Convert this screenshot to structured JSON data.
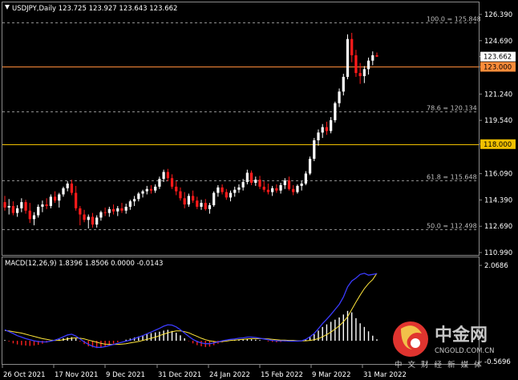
{
  "chart_data": {
    "type": "candlestick",
    "main": {
      "header": "USDJPY,Daily  123.725 123.927 123.643 123.662",
      "y_ticks": [
        "126.390",
        "124.690",
        "123.662",
        "123.000",
        "121.240",
        "119.540",
        "118.000",
        "116.090",
        "114.390",
        "112.690",
        "110.990"
      ],
      "ylim": [
        110.99,
        126.39
      ],
      "price_tag": {
        "label": "123.662",
        "value": 123.662
      },
      "h_lines": [
        {
          "label": "123.000",
          "value": 123.0,
          "color": "#ff8c3a"
        },
        {
          "label": "118.000",
          "value": 118.0,
          "color": "#f0c000"
        }
      ],
      "fib_levels": [
        {
          "label": "100.0 = 125.848",
          "value": 125.848
        },
        {
          "label": "78.6 = 120.134",
          "value": 120.134
        },
        {
          "label": "61.8 = 115.648",
          "value": 115.648
        },
        {
          "label": "50.0 = 112.498",
          "value": 112.498
        }
      ],
      "ohlc": [
        [
          114.25,
          114.65,
          113.7,
          113.9
        ],
        [
          113.9,
          114.45,
          113.45,
          114.0
        ],
        [
          114.0,
          114.3,
          113.4,
          113.55
        ],
        [
          113.55,
          114.05,
          113.3,
          113.85
        ],
        [
          113.85,
          114.5,
          113.6,
          114.25
        ],
        [
          114.25,
          114.4,
          113.5,
          113.7
        ],
        [
          113.7,
          114.2,
          112.9,
          113.15
        ],
        [
          113.15,
          113.6,
          112.75,
          113.4
        ],
        [
          113.4,
          114.1,
          113.25,
          113.95
        ],
        [
          113.95,
          114.35,
          113.6,
          114.1
        ],
        [
          114.1,
          114.5,
          113.8,
          114.0
        ],
        [
          114.0,
          114.75,
          113.85,
          114.6
        ],
        [
          114.6,
          114.95,
          114.2,
          114.35
        ],
        [
          114.35,
          114.85,
          113.9,
          114.75
        ],
        [
          114.75,
          115.25,
          114.6,
          115.15
        ],
        [
          115.15,
          115.6,
          114.95,
          115.45
        ],
        [
          115.45,
          115.7,
          114.7,
          114.85
        ],
        [
          114.85,
          115.3,
          113.7,
          113.85
        ],
        [
          113.85,
          114.0,
          112.75,
          113.45
        ],
        [
          113.45,
          113.75,
          112.95,
          113.1
        ],
        [
          113.1,
          113.45,
          112.55,
          113.3
        ],
        [
          113.3,
          113.55,
          112.6,
          112.8
        ],
        [
          112.8,
          113.4,
          112.6,
          113.25
        ],
        [
          113.25,
          113.7,
          113.05,
          113.6
        ],
        [
          113.6,
          113.9,
          113.35,
          113.55
        ],
        [
          113.55,
          113.95,
          113.3,
          113.8
        ],
        [
          113.8,
          114.1,
          113.45,
          113.65
        ],
        [
          113.65,
          114.0,
          113.35,
          113.85
        ],
        [
          113.85,
          114.2,
          113.55,
          113.7
        ],
        [
          113.7,
          114.15,
          113.5,
          113.95
        ],
        [
          113.95,
          114.4,
          113.75,
          114.3
        ],
        [
          114.3,
          114.65,
          114.0,
          114.45
        ],
        [
          114.45,
          114.9,
          114.3,
          114.8
        ],
        [
          114.8,
          115.05,
          114.55,
          114.95
        ],
        [
          114.95,
          115.3,
          114.75,
          115.1
        ],
        [
          115.1,
          115.35,
          114.8,
          115.0
        ],
        [
          115.0,
          115.4,
          114.85,
          115.25
        ],
        [
          115.25,
          115.9,
          115.1,
          115.75
        ],
        [
          115.75,
          116.35,
          115.55,
          116.2
        ],
        [
          116.2,
          116.4,
          115.6,
          115.8
        ],
        [
          115.8,
          116.05,
          115.1,
          115.25
        ],
        [
          115.25,
          115.6,
          114.7,
          114.95
        ],
        [
          114.95,
          115.2,
          114.35,
          114.5
        ],
        [
          114.5,
          114.9,
          113.85,
          114.1
        ],
        [
          114.1,
          114.8,
          113.95,
          114.65
        ],
        [
          114.65,
          115.0,
          114.2,
          114.35
        ],
        [
          114.35,
          114.6,
          113.8,
          113.95
        ],
        [
          113.95,
          114.4,
          113.75,
          114.2
        ],
        [
          114.2,
          114.45,
          113.7,
          113.8
        ],
        [
          113.8,
          114.2,
          113.5,
          114.05
        ],
        [
          114.05,
          114.95,
          113.95,
          114.85
        ],
        [
          114.85,
          115.35,
          114.6,
          115.2
        ],
        [
          115.2,
          115.4,
          114.75,
          114.9
        ],
        [
          114.9,
          115.1,
          114.4,
          114.55
        ],
        [
          114.55,
          115.0,
          114.3,
          114.85
        ],
        [
          114.85,
          115.25,
          114.6,
          115.05
        ],
        [
          115.05,
          115.4,
          114.85,
          115.2
        ],
        [
          115.2,
          115.75,
          115.0,
          115.55
        ],
        [
          115.55,
          116.35,
          115.4,
          116.15
        ],
        [
          116.15,
          116.3,
          115.35,
          115.5
        ],
        [
          115.5,
          115.9,
          115.3,
          115.7
        ],
        [
          115.7,
          115.95,
          115.1,
          115.25
        ],
        [
          115.25,
          115.6,
          114.9,
          115.05
        ],
        [
          115.05,
          115.45,
          114.75,
          114.9
        ],
        [
          114.9,
          115.3,
          114.65,
          115.15
        ],
        [
          115.15,
          115.4,
          114.85,
          115.0
        ],
        [
          115.0,
          115.5,
          114.8,
          115.35
        ],
        [
          115.35,
          115.8,
          115.1,
          115.65
        ],
        [
          115.65,
          115.9,
          115.0,
          115.1
        ],
        [
          115.1,
          115.35,
          114.7,
          114.9
        ],
        [
          114.9,
          115.4,
          114.8,
          115.3
        ],
        [
          115.3,
          115.6,
          115.0,
          115.45
        ],
        [
          115.45,
          116.25,
          115.35,
          116.1
        ],
        [
          116.1,
          117.2,
          116.0,
          117.05
        ],
        [
          117.05,
          118.4,
          116.9,
          118.25
        ],
        [
          118.25,
          118.95,
          117.9,
          118.75
        ],
        [
          118.75,
          119.3,
          118.4,
          119.1
        ],
        [
          119.1,
          119.45,
          118.6,
          118.85
        ],
        [
          118.85,
          119.75,
          118.7,
          119.55
        ],
        [
          119.55,
          120.75,
          119.4,
          120.65
        ],
        [
          120.65,
          121.6,
          120.4,
          121.4
        ],
        [
          121.4,
          122.55,
          121.15,
          122.35
        ],
        [
          122.35,
          125.1,
          122.2,
          124.8
        ],
        [
          124.8,
          125.2,
          123.3,
          123.75
        ],
        [
          123.75,
          124.1,
          122.35,
          122.6
        ],
        [
          122.6,
          123.25,
          121.9,
          122.4
        ],
        [
          122.4,
          123.05,
          121.95,
          122.85
        ],
        [
          122.85,
          123.6,
          122.5,
          123.4
        ],
        [
          123.4,
          124.0,
          123.1,
          123.75
        ],
        [
          123.75,
          123.93,
          123.64,
          123.66
        ]
      ]
    },
    "macd": {
      "header": "MACD(12,26,9) 1.8396 1.8506 0.0000 -0.0143",
      "y_ticks": [
        "2.0686",
        "-0.5696"
      ],
      "ylim": [
        -0.5696,
        2.0686
      ],
      "histogram": [
        0.02,
        -0.02,
        -0.07,
        -0.1,
        -0.12,
        -0.13,
        -0.14,
        -0.13,
        -0.11,
        -0.08,
        -0.05,
        -0.02,
        0.01,
        0.04,
        0.07,
        0.09,
        0.1,
        0.06,
        -0.02,
        -0.09,
        -0.15,
        -0.18,
        -0.2,
        -0.19,
        -0.16,
        -0.12,
        -0.08,
        -0.04,
        0.0,
        0.03,
        0.06,
        0.09,
        0.12,
        0.15,
        0.18,
        0.21,
        0.23,
        0.25,
        0.28,
        0.3,
        0.27,
        0.22,
        0.15,
        0.07,
        -0.01,
        -0.07,
        -0.12,
        -0.15,
        -0.17,
        -0.16,
        -0.12,
        -0.08,
        -0.04,
        -0.01,
        0.01,
        0.02,
        0.03,
        0.04,
        0.05,
        0.04,
        0.03,
        0.02,
        0.0,
        -0.02,
        -0.03,
        -0.04,
        -0.03,
        -0.02,
        -0.02,
        -0.02,
        -0.01,
        0.0,
        0.04,
        0.1,
        0.18,
        0.28,
        0.38,
        0.45,
        0.52,
        0.58,
        0.64,
        0.72,
        0.82,
        0.78,
        0.62,
        0.48,
        0.38,
        0.26,
        0.14,
        0.04
      ],
      "macd_line": [
        0.3,
        0.25,
        0.2,
        0.14,
        0.1,
        0.06,
        0.03,
        0.0,
        -0.02,
        -0.03,
        -0.03,
        -0.01,
        0.02,
        0.06,
        0.11,
        0.16,
        0.18,
        0.13,
        0.05,
        -0.03,
        -0.1,
        -0.15,
        -0.18,
        -0.18,
        -0.16,
        -0.13,
        -0.1,
        -0.07,
        -0.04,
        -0.01,
        0.02,
        0.06,
        0.1,
        0.14,
        0.19,
        0.24,
        0.29,
        0.34,
        0.4,
        0.44,
        0.43,
        0.38,
        0.3,
        0.21,
        0.12,
        0.04,
        -0.02,
        -0.06,
        -0.08,
        -0.08,
        -0.06,
        -0.03,
        0.0,
        0.02,
        0.04,
        0.05,
        0.07,
        0.08,
        0.1,
        0.1,
        0.09,
        0.07,
        0.05,
        0.03,
        0.01,
        0.0,
        0.0,
        0.0,
        -0.01,
        -0.01,
        -0.01,
        0.0,
        0.04,
        0.11,
        0.2,
        0.33,
        0.47,
        0.59,
        0.72,
        0.86,
        1.0,
        1.2,
        1.48,
        1.64,
        1.72,
        1.82,
        1.85,
        1.8,
        1.82,
        1.84
      ],
      "signal_line": [
        0.28,
        0.27,
        0.25,
        0.23,
        0.21,
        0.18,
        0.15,
        0.12,
        0.09,
        0.06,
        0.04,
        0.02,
        0.01,
        0.01,
        0.03,
        0.05,
        0.07,
        0.08,
        0.07,
        0.05,
        0.02,
        -0.01,
        -0.04,
        -0.07,
        -0.09,
        -0.1,
        -0.1,
        -0.1,
        -0.09,
        -0.08,
        -0.06,
        -0.04,
        -0.02,
        0.01,
        0.04,
        0.07,
        0.1,
        0.14,
        0.18,
        0.22,
        0.25,
        0.27,
        0.27,
        0.25,
        0.22,
        0.17,
        0.12,
        0.07,
        0.03,
        0.0,
        -0.02,
        -0.03,
        -0.02,
        -0.01,
        0.01,
        0.02,
        0.03,
        0.04,
        0.05,
        0.06,
        0.06,
        0.06,
        0.06,
        0.05,
        0.04,
        0.03,
        0.02,
        0.02,
        0.01,
        0.01,
        0.0,
        0.0,
        0.0,
        0.01,
        0.03,
        0.06,
        0.11,
        0.17,
        0.24,
        0.32,
        0.41,
        0.52,
        0.66,
        0.86,
        1.06,
        1.25,
        1.43,
        1.57,
        1.68,
        1.85
      ]
    },
    "x_ticks": [
      "26 Oct 2021",
      "17 Nov 2021",
      "9 Dec 2021",
      "31 Dec 2021",
      "24 Jan 2022",
      "15 Feb 2022",
      "9 Mar 2022",
      "31 Mar 2022"
    ],
    "colors": {
      "bull_candle": "#ffffff",
      "bear_candle": "#ff1a1a",
      "grid_dashes": "#bfbfbf",
      "macd_line": "#3b3bff",
      "signal_line": "#ffe63c",
      "hist_positive": "#ffffff",
      "hist_negative": "#ff2020",
      "price_tag_bg": "#ffffff",
      "orange_line_tag_bg": "#ff8c3a",
      "yellow_line_tag_bg": "#f0c000"
    }
  },
  "watermark": {
    "logo": "中金网",
    "domain": "CNGOLD.COM.CN",
    "subtitle": "中 文 财 经 新 媒 体"
  }
}
